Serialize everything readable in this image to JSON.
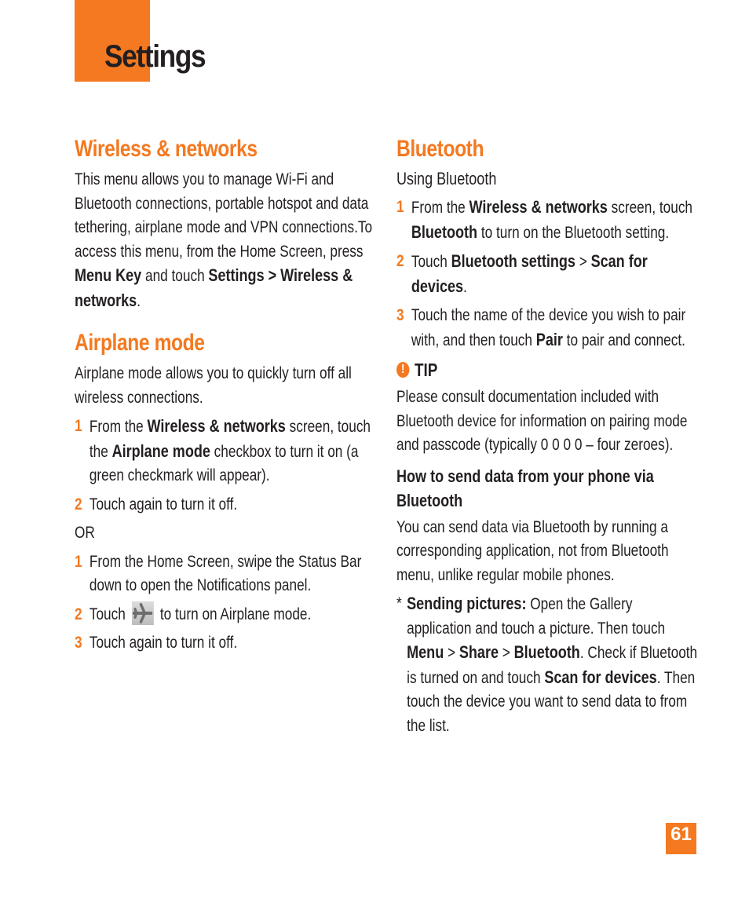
{
  "header": {
    "title": "Settings",
    "accent_color": "#f47920"
  },
  "wireless": {
    "heading": "Wireless & networks",
    "intro_1": "This menu allows you to manage Wi-Fi and Bluetooth connections, portable hotspot and data tethering, airplane mode and VPN connections.To access this menu, from the Home Screen, press ",
    "menu_key": "Menu Key",
    "intro_2": " and touch ",
    "path": "Settings > Wireless & networks",
    "intro_end": "."
  },
  "airplane": {
    "heading": "Airplane mode",
    "intro": "Airplane mode allows you to quickly turn off all wireless connections.",
    "steps_a": [
      {
        "num": "1",
        "t1": "From the ",
        "b1": "Wireless & networks",
        "t2": " screen, touch the ",
        "b2": "Airplane mode",
        "t3": " checkbox to turn it on (a green checkmark will appear)."
      },
      {
        "num": "2",
        "text": "Touch again to turn it off."
      }
    ],
    "or": "OR",
    "steps_b": [
      {
        "num": "1",
        "text": "From the Home Screen, swipe the Status Bar down to open the Notifications panel."
      },
      {
        "num": "2",
        "t1": "Touch",
        "icon": "airplane-icon",
        "t2": "to turn on Airplane mode."
      },
      {
        "num": "3",
        "text": "Touch again to turn it off."
      }
    ]
  },
  "bluetooth": {
    "heading": "Bluetooth",
    "subheading": "Using Bluetooth",
    "steps": [
      {
        "num": "1",
        "t1": "From the ",
        "b1": "Wireless & networks",
        "t2": " screen, touch ",
        "b2": "Bluetooth",
        "t3": " to turn on the Bluetooth setting."
      },
      {
        "num": "2",
        "t1": "Touch ",
        "b1": "Bluetooth settings",
        "t2": " > ",
        "b2": "Scan for devices",
        "t3": "."
      },
      {
        "num": "3",
        "t1": "Touch the name of the device you wish to pair with, and then touch ",
        "b1": "Pair",
        "t2": " to pair and connect."
      }
    ],
    "tip": {
      "icon": "!",
      "label": "TIP",
      "text": "Please consult documentation included with Bluetooth device for information on pairing mode and passcode (typically 0 0 0 0 – four zeroes)."
    },
    "send_heading": "How to send data from your phone via Bluetooth",
    "send_intro": "You can send data via Bluetooth by running a corresponding application, not from Bluetooth menu, unlike regular mobile phones.",
    "bullet": {
      "star": "*",
      "b1": "Sending pictures:",
      "t1": " Open the Gallery application and touch a picture. Then touch ",
      "b2": "Menu",
      "s1": " > ",
      "b3": "Share",
      "s2": " > ",
      "b4": "Bluetooth",
      "t2": ". Check if Bluetooth is turned on and touch ",
      "b5": "Scan for devices",
      "t3": ". Then touch the device you want to send data to from the list."
    }
  },
  "footer": {
    "page_number": "61"
  }
}
